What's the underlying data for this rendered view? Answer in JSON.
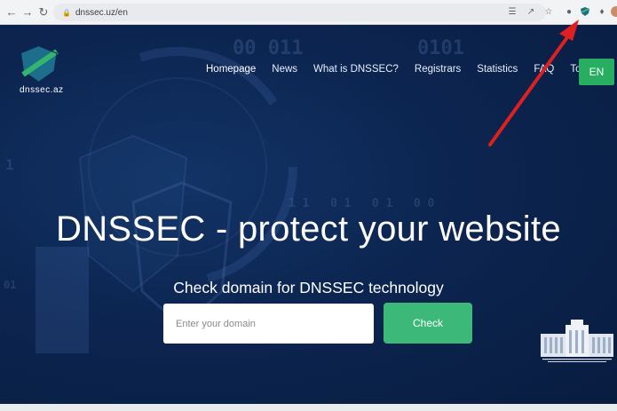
{
  "browser": {
    "url": "dnssec.uz/en",
    "back_icon": "back-arrow-icon",
    "forward_icon": "forward-arrow-icon",
    "reload_icon": "reload-icon",
    "lock_icon": "lock-icon"
  },
  "site": {
    "logo_text": "dnssec.az",
    "nav": [
      {
        "label": "Homepage"
      },
      {
        "label": "News"
      },
      {
        "label": "What is DNSSEC?"
      },
      {
        "label": "Registrars"
      },
      {
        "label": "Statistics"
      },
      {
        "label": "FAQ"
      },
      {
        "label": "Tools"
      }
    ],
    "lang": "EN",
    "hero": {
      "title": "DNSSEC - protect your website",
      "subtitle": "Check domain for DNSSEC technology"
    },
    "search": {
      "placeholder": "Enter your domain",
      "button": "Check"
    }
  },
  "colors": {
    "background": "#0b2349",
    "accent": "#3cb878",
    "arrow": "#e02020"
  }
}
